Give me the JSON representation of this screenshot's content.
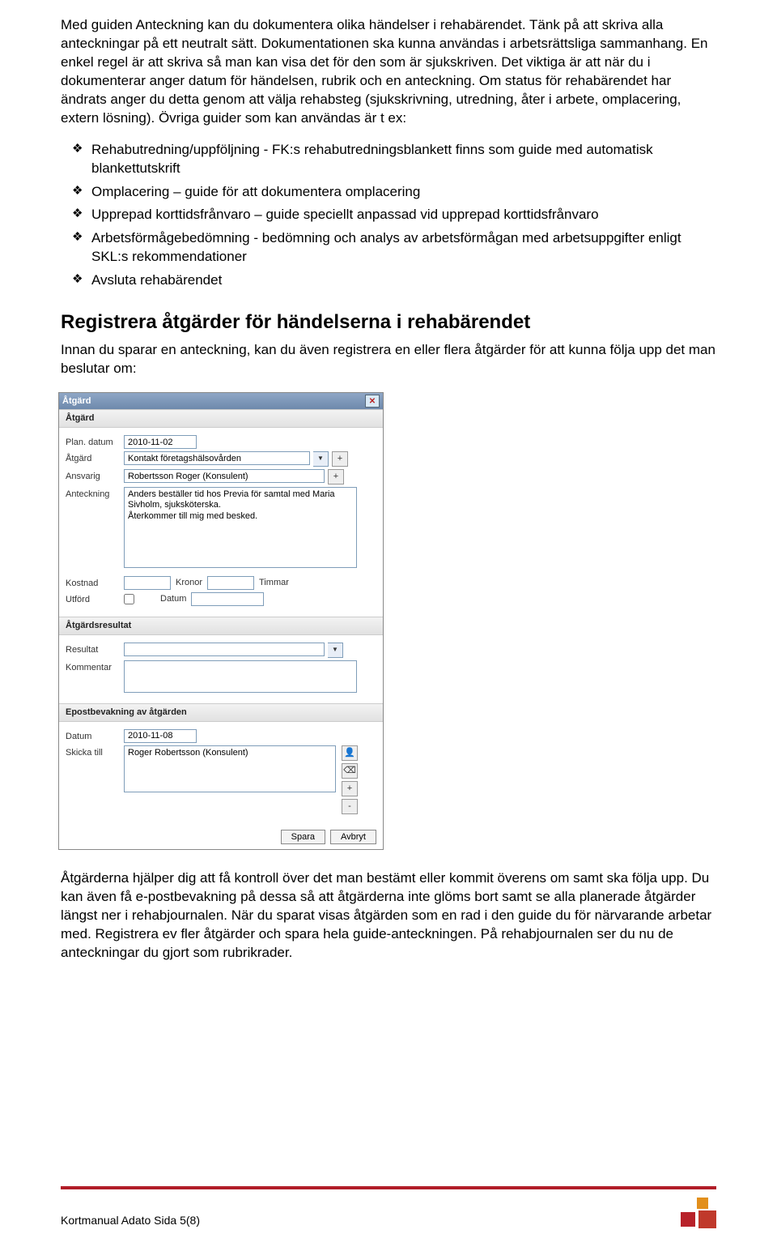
{
  "intro": {
    "text": "Med guiden Anteckning kan du dokumentera olika händelser i rehabärendet. Tänk på att skriva alla anteckningar på ett neutralt sätt. Dokumentationen ska kunna användas i arbetsrättsliga sammanhang. En enkel regel är att skriva så man kan visa det för den som är sjukskriven. Det viktiga är att när du i dokumenterar anger datum för händelsen, rubrik och en anteckning. Om status för rehabärendet har ändrats anger du detta genom att välja rehabsteg (sjukskrivning, utredning, åter i arbete, omplacering, extern lösning). Övriga guider som kan användas är t ex:"
  },
  "bullets": [
    "Rehabutredning/uppföljning - FK:s rehabutredningsblankett finns som guide med automatisk blankettutskrift",
    "Omplacering – guide för att dokumentera omplacering",
    "Upprepad korttidsfrånvaro – guide speciellt anpassad vid upprepad korttidsfrånvaro",
    "Arbetsförmågebedömning - bedömning och analys av arbetsförmågan med arbetsuppgifter enligt SKL:s rekommendationer",
    "Avsluta rehabärendet"
  ],
  "heading": "Registrera åtgärder för händelserna i rehabärendet",
  "heading_sub": "Innan du sparar en anteckning, kan du även registrera en eller flera åtgärder för att kunna följa upp det man beslutar om:",
  "dialog": {
    "title": "Åtgärd",
    "section1": "Åtgärd",
    "labels": {
      "plan_datum": "Plan. datum",
      "atgard": "Åtgärd",
      "ansvarig": "Ansvarig",
      "anteckning": "Anteckning",
      "kostnad": "Kostnad",
      "kronor": "Kronor",
      "timmar": "Timmar",
      "utford": "Utförd",
      "datum": "Datum"
    },
    "values": {
      "plan_datum": "2010-11-02",
      "atgard": "Kontakt företagshälsovården",
      "ansvarig": "Robertsson Roger (Konsulent)",
      "anteckning": "Anders beställer tid hos Previa för samtal med Maria Sivholm, sjuksköterska.\nÅterkommer till mig med besked.",
      "kostnad": "",
      "timmar": "",
      "datum_utford": ""
    },
    "section2": "Åtgärdsresultat",
    "labels2": {
      "resultat": "Resultat",
      "kommentar": "Kommentar"
    },
    "section3": "Epostbevakning av åtgärden",
    "labels3": {
      "datum": "Datum",
      "skicka": "Skicka till"
    },
    "values3": {
      "datum": "2010-11-08",
      "skicka": "Roger Robertsson (Konsulent)"
    },
    "buttons": {
      "spara": "Spara",
      "avbryt": "Avbryt"
    }
  },
  "closing": "Åtgärderna hjälper dig att få kontroll över det man bestämt eller kommit överens om samt ska följa upp. Du kan även få e-postbevakning på dessa så att åtgärderna inte glöms bort samt se alla planerade åtgärder längst ner i rehabjournalen. När du sparat visas åtgärden som en rad i den guide du för närvarande arbetar med. Registrera ev fler åtgärder och spara hela guide-anteckningen. På rehabjournalen ser du nu de anteckningar du gjort som rubrikrader.",
  "footer": "Kortmanual Adato Sida 5(8)"
}
